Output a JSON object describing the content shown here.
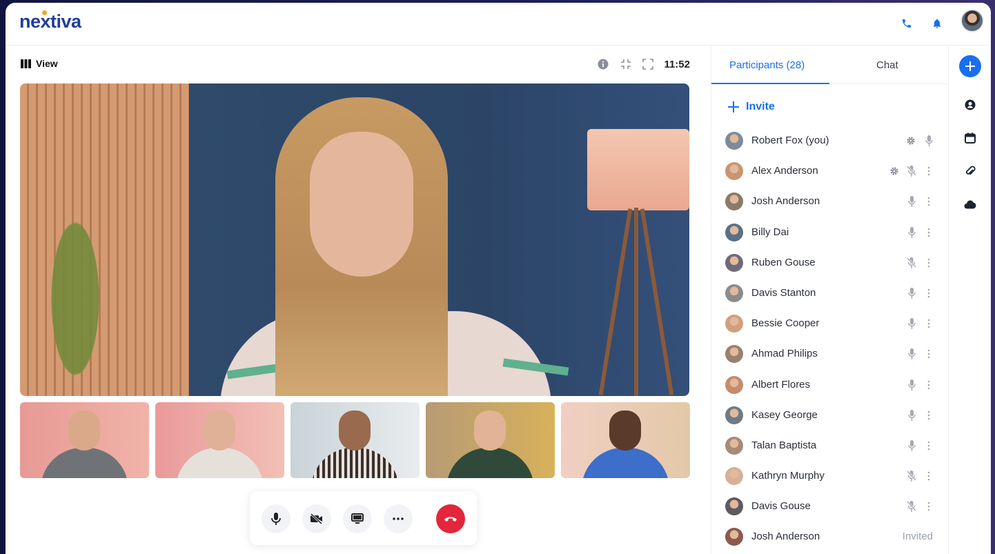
{
  "brand": {
    "logo_text": "nextiva"
  },
  "header": {
    "icons": [
      "phone-icon",
      "bell-icon"
    ],
    "avatar_name": "user-avatar"
  },
  "stage": {
    "view_label": "View",
    "timer": "11:52",
    "tool_icons": [
      "info-icon",
      "collapse-icon",
      "expand-icon"
    ]
  },
  "controls": {
    "buttons": [
      "microphone-icon",
      "camera-off-icon",
      "screen-share-icon",
      "more-icon",
      "end-call-icon"
    ]
  },
  "panel": {
    "tabs": [
      {
        "label": "Participants (28)",
        "active": true
      },
      {
        "label": "Chat",
        "active": false
      }
    ],
    "invite_label": "Invite",
    "participants": [
      {
        "name": "Robert Fox (you)",
        "icons": [
          "settings",
          "mic"
        ],
        "status": ""
      },
      {
        "name": "Alex Anderson",
        "icons": [
          "settings",
          "mic-off",
          "more"
        ],
        "status": ""
      },
      {
        "name": "Josh Anderson",
        "icons": [
          "mic",
          "more"
        ],
        "status": ""
      },
      {
        "name": "Billy Dai",
        "icons": [
          "mic",
          "more"
        ],
        "status": ""
      },
      {
        "name": "Ruben Gouse",
        "icons": [
          "mic-off",
          "more"
        ],
        "status": ""
      },
      {
        "name": "Davis Stanton",
        "icons": [
          "mic",
          "more"
        ],
        "status": ""
      },
      {
        "name": "Bessie Cooper",
        "icons": [
          "mic",
          "more"
        ],
        "status": ""
      },
      {
        "name": "Ahmad Philips",
        "icons": [
          "mic",
          "more"
        ],
        "status": ""
      },
      {
        "name": "Albert Flores",
        "icons": [
          "mic",
          "more"
        ],
        "status": ""
      },
      {
        "name": "Kasey George",
        "icons": [
          "mic",
          "more"
        ],
        "status": ""
      },
      {
        "name": "Talan Baptista",
        "icons": [
          "mic",
          "more"
        ],
        "status": ""
      },
      {
        "name": "Kathryn Murphy",
        "icons": [
          "mic-off",
          "more"
        ],
        "status": ""
      },
      {
        "name": "Davis Gouse",
        "icons": [
          "mic-off",
          "more"
        ],
        "status": ""
      },
      {
        "name": "Josh Anderson",
        "icons": [],
        "status": "Invited"
      }
    ]
  },
  "rail": {
    "icons": [
      "add-icon",
      "contacts-icon",
      "calendar-icon",
      "attachment-icon",
      "cloud-icon"
    ]
  },
  "colors": {
    "accent": "#1a6ff0",
    "brand_blue": "#1f3f9a",
    "brand_dot": "#f5a623",
    "end_call": "#e3263b"
  }
}
